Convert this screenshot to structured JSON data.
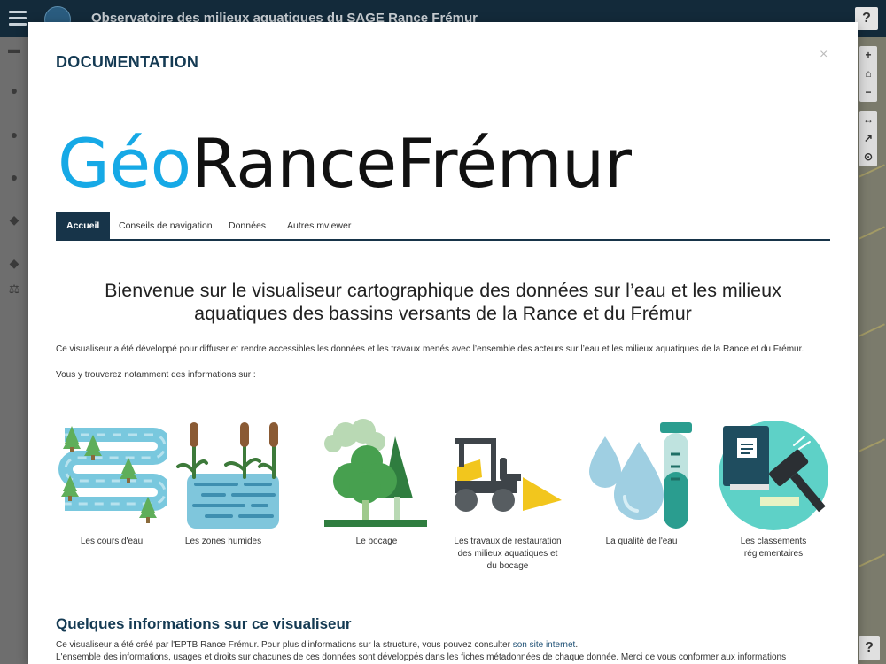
{
  "app": {
    "title": "Observatoire des milieux aquatiques du SAGE Rance Frémur",
    "help_label": "?"
  },
  "map_tools": {
    "zoom_in": "+",
    "home": "⌂",
    "zoom_out": "−",
    "measure": "↔",
    "share": "↗",
    "info": "⊙",
    "help": "?"
  },
  "modal": {
    "title": "DOCUMENTATION",
    "close": "×",
    "brand_part1": "Géo",
    "brand_part2": "RanceFrémur",
    "tabs": [
      {
        "label": "Accueil",
        "active": true
      },
      {
        "label": "Conseils de navigation",
        "active": false
      },
      {
        "label": "Données",
        "active": false
      },
      {
        "label": "Autres mviewer",
        "active": false
      }
    ],
    "welcome_heading": "Bienvenue sur le visualiseur cartographique des données sur l’eau et les milieux aquatiques des bassins versants de la Rance et du Frémur",
    "intro": "Ce visualiseur a été développé pour diffuser et rendre accessibles les données et les travaux menés avec l’ensemble des acteurs sur l’eau et les milieux aquatiques de la Rance et du Frémur.",
    "intro2": "Vous y trouverez notamment des informations sur :",
    "themes": [
      {
        "label": "Les cours d'eau",
        "icon": "river-icon"
      },
      {
        "label": "Les zones humides",
        "icon": "wetland-icon"
      },
      {
        "label": "Le bocage",
        "icon": "hedgerow-icon"
      },
      {
        "label": "Les travaux de restauration des milieux aquatiques et du bocage",
        "icon": "bulldozer-icon"
      },
      {
        "label": "La qualité de l'eau",
        "icon": "water-quality-icon"
      },
      {
        "label": "Les classements réglementaires",
        "icon": "regulation-icon"
      }
    ],
    "info_heading": "Quelques informations sur ce visualiseur",
    "info_p1_text": "Ce visualiseur a été créé par l'EPTB Rance Frémur. Pour plus d'informations sur la structure, vous pouvez consulter ",
    "info_p1_link": "son site internet",
    "info_p1_end": ".",
    "info_p2": "L'ensemble des informations, usages et droits sur chacunes de ces données sont développés dans les fiches métadonnées de chaque donnée. Merci de vous conformer aux informations"
  },
  "colors": {
    "topbar": "#132a3a",
    "accent": "#173449",
    "brand_blue": "#16a9e6",
    "river": "#79c8de",
    "tree_green": "#5fae5a",
    "bulldozer_yellow": "#f2c61d",
    "water_drop": "#9fcfe2",
    "teal": "#2a9d8f"
  }
}
